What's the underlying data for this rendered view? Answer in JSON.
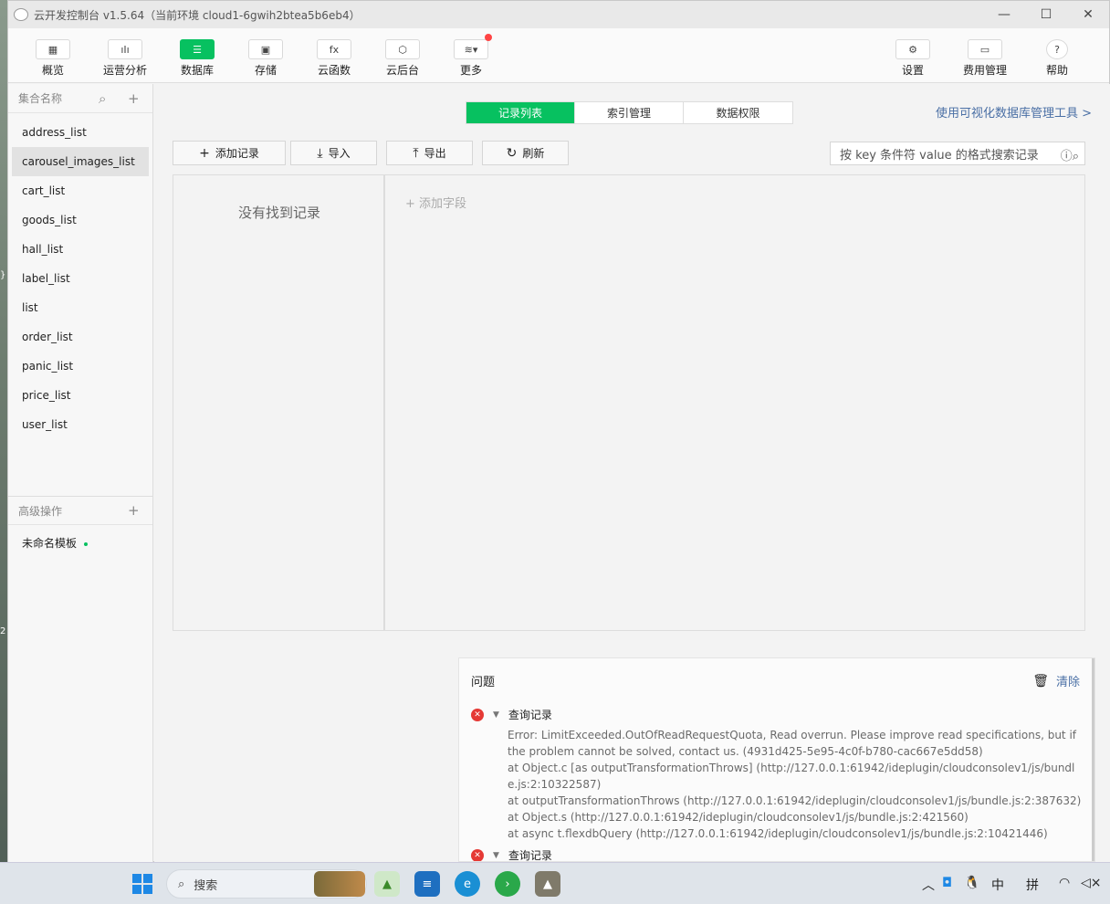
{
  "window": {
    "title": "云开发控制台 v1.5.64（当前环境 cloud1-6gwih2btea5b6eb4）",
    "controls": [
      "—",
      "☐",
      "✕"
    ]
  },
  "toolbar": {
    "left": [
      {
        "label": "概览",
        "icon": "grid-icon",
        "glyph": "▦"
      },
      {
        "label": "运营分析",
        "icon": "bar-chart-icon",
        "glyph": "ıIı"
      },
      {
        "label": "数据库",
        "icon": "database-icon",
        "glyph": "☰"
      },
      {
        "label": "存储",
        "icon": "save-icon",
        "glyph": "▣"
      },
      {
        "label": "云函数",
        "icon": "function-icon",
        "glyph": "fx"
      },
      {
        "label": "云后台",
        "icon": "cube-icon",
        "glyph": "⬡"
      },
      {
        "label": "更多",
        "icon": "layers-icon",
        "glyph": "≋▾"
      }
    ],
    "right": [
      {
        "label": "设置",
        "icon": "gear-icon",
        "glyph": "⚙"
      },
      {
        "label": "费用管理",
        "icon": "billing-icon",
        "glyph": "▭"
      },
      {
        "label": "帮助",
        "icon": "help-icon",
        "glyph": "?"
      }
    ]
  },
  "sidebar": {
    "header": "集合名称",
    "collections": [
      "address_list",
      "carousel_images_list",
      "cart_list",
      "goods_list",
      "hall_list",
      "label_list",
      "list",
      "order_list",
      "panic_list",
      "price_list",
      "user_list"
    ],
    "selected": "carousel_images_list",
    "advanced_header": "高级操作",
    "templates": [
      "未命名模板"
    ]
  },
  "tabs": [
    "记录列表",
    "索引管理",
    "数据权限"
  ],
  "active_tab": "记录列表",
  "visual_tool_link": "使用可视化数据库管理工具 >",
  "actions": {
    "add_record": "添加记录",
    "import": "导入",
    "export": "导出",
    "refresh": "刷新"
  },
  "search": {
    "placeholder": "按 key 条件符 value 的格式搜索记录"
  },
  "records": {
    "empty_text": "没有找到记录",
    "add_field": "添加字段"
  },
  "problems": {
    "title": "问题",
    "clear": "清除",
    "entries": [
      {
        "label": "查询记录",
        "lines": [
          "Error: LimitExceeded.OutOfReadRequestQuota, Read overrun. Please improve read specifications, but if the problem cannot be solved, contact us. (4931d425-5e95-4c0f-b780-cac667e5dd58)",
          "at Object.c [as outputTransformationThrows] (http://127.0.0.1:61942/ideplugin/cloudconsolev1/js/bundle.js:2:10322587)",
          "at outputTransformationThrows (http://127.0.0.1:61942/ideplugin/cloudconsolev1/js/bundle.js:2:387632)",
          "at Object.s (http://127.0.0.1:61942/ideplugin/cloudconsolev1/js/bundle.js:2:421560)",
          "at async t.flexdbQuery (http://127.0.0.1:61942/ideplugin/cloudconsolev1/js/bundle.js:2:10421446)"
        ]
      },
      {
        "label": "查询记录",
        "lines": []
      }
    ]
  },
  "taskbar": {
    "search_label": "搜索",
    "tray": {
      "ime_lang": "中",
      "ime_mode": "拼"
    }
  },
  "desktop_edge": {
    "top": "}",
    "bottom": "2"
  }
}
